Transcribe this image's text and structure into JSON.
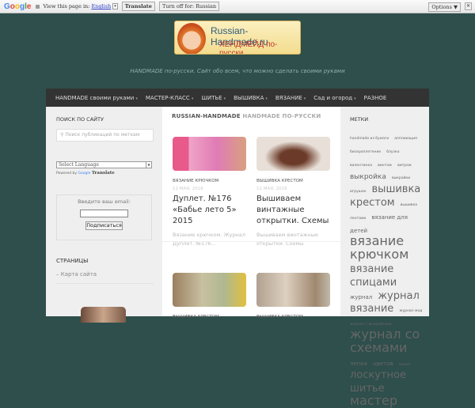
{
  "translate_bar": {
    "brand": "Google",
    "prompt": "View this page in:",
    "language": "English",
    "translate_label": "Translate",
    "turn_off_label": "Turn off for: Russian",
    "options_label": "Options ▼",
    "close": "✕"
  },
  "site": {
    "logo_line1": "Russian-Handmade.ru",
    "logo_line2": "ХЕНДМЕЙД по-русски",
    "tagline": "HANDMADE по-русски. Сайт обо всем, что можно сделать своими руками"
  },
  "nav": [
    {
      "label": "HANDMADE своими руками",
      "dropdown": true
    },
    {
      "label": "МАСТЕР-КЛАСС",
      "dropdown": true
    },
    {
      "label": "ШИТЬЕ",
      "dropdown": true
    },
    {
      "label": "ВЫШИВКА",
      "dropdown": true
    },
    {
      "label": "ВЯЗАНИЕ",
      "dropdown": true
    },
    {
      "label": "Сад и огород",
      "dropdown": true
    },
    {
      "label": "РАЗНОЕ",
      "dropdown": false
    }
  ],
  "left": {
    "search_title": "ПОИСК ПО САЙТУ",
    "search_placeholder": "Поиск публикаций по меткам",
    "lang_select": "Select Language",
    "powered_by": "Powered by",
    "google": "Google",
    "translate": "Translate",
    "email_label": "Введите ваш email:",
    "subscribe": "Подписаться",
    "pages_title": "СТРАНИЦЫ",
    "sitemap": "– Карта сайта"
  },
  "main": {
    "title": "RUSSIAN-HANDMADE",
    "subtitle": "HANDMADE ПО-РУССКИ",
    "posts": [
      {
        "category": "ВЯЗАНИЕ КРЮЧКОМ",
        "date": "11 МАЯ, 2016",
        "title": "Дуплет. №176 «Бабье лето 5» 2015",
        "excerpt": "Вязание крючком. Журнал Дуплет. №176..."
      },
      {
        "category": "ВЫШИВКА КРЕСТОМ",
        "date": "11 МАЯ, 2016",
        "title": "Вышиваем винтажные открытки. Схемы",
        "excerpt": "Вышиваем винтажные открытки. Схемы"
      },
      {
        "category": "ВЫШИВКА КРЕСТОМ"
      },
      {
        "category": "ВЫШИВКА КРЕСТОМ"
      }
    ]
  },
  "right": {
    "title": "МЕТКИ",
    "tags": [
      {
        "label": "handmade из бумаги",
        "weight": 1
      },
      {
        "label": "аппликация",
        "weight": 1
      },
      {
        "label": "бисероплетение",
        "weight": 1
      },
      {
        "label": "блузка",
        "weight": 1
      },
      {
        "label": "валентинка",
        "weight": 1
      },
      {
        "label": "винтаж",
        "weight": 1
      },
      {
        "label": "витраж",
        "weight": 1
      },
      {
        "label": "выкройка",
        "weight": 3
      },
      {
        "label": "выкройки игрушек",
        "weight": 1
      },
      {
        "label": "вышивка крестом",
        "weight": 4
      },
      {
        "label": "вышивка лентами",
        "weight": 1
      },
      {
        "label": "вязание для детей",
        "weight": 2
      },
      {
        "label": "вязание крючком",
        "weight": 5
      },
      {
        "label": "вязание спицами",
        "weight": 4
      },
      {
        "label": "журнал",
        "weight": 2
      },
      {
        "label": "журнал вязание",
        "weight": 4
      },
      {
        "label": "журнал мод",
        "weight": 1
      },
      {
        "label": "журнал с выкройками",
        "weight": 1
      },
      {
        "label": "журнал со схемами",
        "weight": 5
      },
      {
        "label": "лепка",
        "weight": 2
      },
      {
        "label": "цветов",
        "weight": 2
      },
      {
        "label": "лилия",
        "weight": 1
      },
      {
        "label": "лоскутное шитье",
        "weight": 4
      },
      {
        "label": "мастер",
        "weight": 5
      }
    ]
  }
}
